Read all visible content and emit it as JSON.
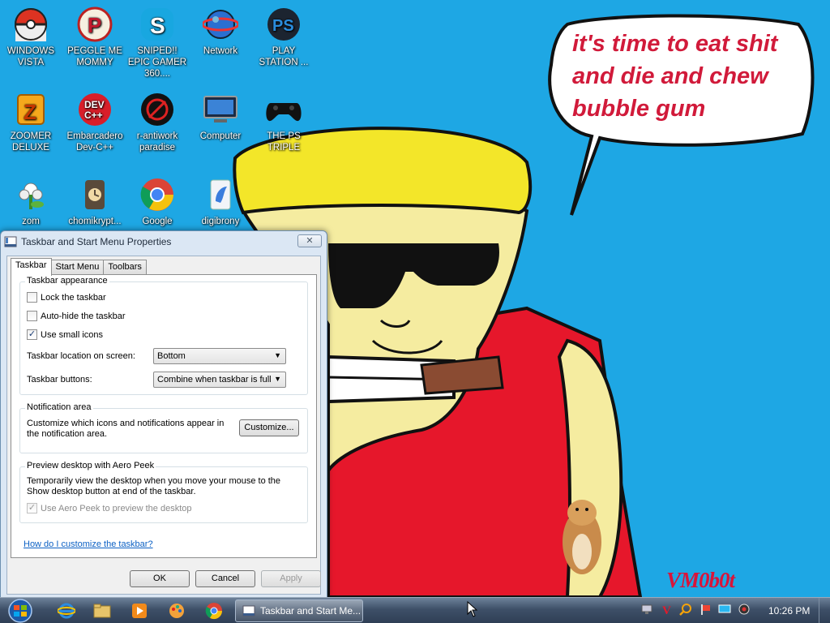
{
  "wallpaper": {
    "speech_text": "it's time to eat shit and die and chew bubble gum",
    "signature": "VM0b0t"
  },
  "desktop_icons": [
    {
      "label": "WINDOWS VISTA",
      "icon": "pokeball-icon"
    },
    {
      "label": "PEGGLE ME MOMMY",
      "icon": "peggle-icon"
    },
    {
      "label": "SNIPED!! EPIC GAMER 360....",
      "icon": "skype-icon"
    },
    {
      "label": "Network",
      "icon": "network-globe-icon"
    },
    {
      "label": "PLAY STATION ...",
      "icon": "playstation-icon"
    },
    {
      "label": "ZOOMER DELUXE",
      "icon": "zuma-icon"
    },
    {
      "label": "Embarcadero Dev-C++",
      "icon": "devcpp-icon"
    },
    {
      "label": "r-antiwork paradise",
      "icon": "antiwork-icon"
    },
    {
      "label": "Computer",
      "icon": "computer-icon"
    },
    {
      "label": "THE PS TRIPLE",
      "icon": "gamepad-icon"
    },
    {
      "label": "zom",
      "icon": "pvz-icon"
    },
    {
      "label": "chomikrypt...",
      "icon": "chomikrypt-icon"
    },
    {
      "label": "Google",
      "icon": "chrome-icon"
    },
    {
      "label": "digibrony",
      "icon": "digibrony-icon"
    }
  ],
  "dialog": {
    "title": "Taskbar and Start Menu Properties",
    "close_label": "✕",
    "tabs": [
      {
        "label": "Taskbar",
        "active": true
      },
      {
        "label": "Start Menu",
        "active": false
      },
      {
        "label": "Toolbars",
        "active": false
      }
    ],
    "appearance": {
      "title": "Taskbar appearance",
      "lock_label": "Lock the taskbar",
      "lock_checked": false,
      "autohide_label": "Auto-hide the taskbar",
      "autohide_checked": false,
      "small_icons_label": "Use small icons",
      "small_icons_checked": true,
      "location_label": "Taskbar location on screen:",
      "location_value": "Bottom",
      "buttons_label": "Taskbar buttons:",
      "buttons_value": "Combine when taskbar is full"
    },
    "notification": {
      "title": "Notification area",
      "text": "Customize which icons and notifications appear in the notification area.",
      "customize_label": "Customize..."
    },
    "aero_peek": {
      "title": "Preview desktop with Aero Peek",
      "text": "Temporarily view the desktop when you move your mouse to the Show desktop button at end of the taskbar.",
      "checkbox_label": "Use Aero Peek to preview the desktop",
      "checked": true,
      "disabled": true
    },
    "help_link": "How do I customize the taskbar?",
    "ok_label": "OK",
    "cancel_label": "Cancel",
    "apply_label": "Apply"
  },
  "taskbar": {
    "pinned": [
      "internet-explorer-icon",
      "folder-icon",
      "media-player-icon",
      "paint-app-icon",
      "chrome-icon"
    ],
    "active_task": "Taskbar and Start Me...",
    "tray_icons": [
      "network-tray-icon",
      "v-tray-icon",
      "search-tray-icon",
      "flag-tray-icon",
      "monitor-tray-icon",
      "speaker-tray-icon"
    ],
    "clock": "10:26 PM"
  }
}
